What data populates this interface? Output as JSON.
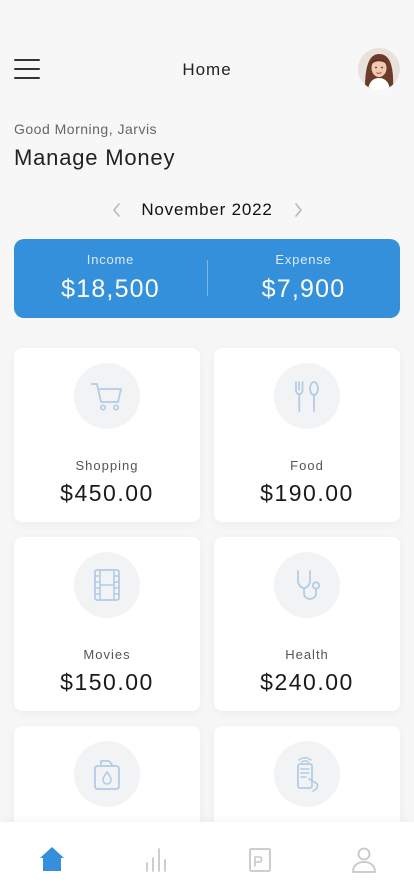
{
  "header": {
    "title": "Home"
  },
  "greeting": "Good Morning, Jarvis",
  "heading": "Manage Money",
  "month_nav": {
    "label": "November 2022"
  },
  "summary": {
    "income_label": "Income",
    "income_value": "$18,500",
    "expense_label": "Expense",
    "expense_value": "$7,900"
  },
  "categories": [
    {
      "label": "Shopping",
      "amount": "$450.00",
      "icon": "shopping-cart-icon"
    },
    {
      "label": "Food",
      "amount": "$190.00",
      "icon": "fork-spoon-icon"
    },
    {
      "label": "Movies",
      "amount": "$150.00",
      "icon": "film-icon"
    },
    {
      "label": "Health",
      "amount": "$240.00",
      "icon": "stethoscope-icon"
    },
    {
      "label": "",
      "amount": "",
      "icon": "water-bottle-icon"
    },
    {
      "label": "",
      "amount": "",
      "icon": "phone-bill-icon"
    }
  ],
  "bottom_nav": {
    "items": [
      {
        "icon": "home-icon",
        "active": true
      },
      {
        "icon": "chart-icon",
        "active": false
      },
      {
        "icon": "wallet-icon",
        "active": false
      },
      {
        "icon": "profile-icon",
        "active": false
      }
    ]
  },
  "colors": {
    "accent": "#3590dc",
    "icon_muted": "#b3cbe6",
    "nav_inactive": "#c8c8c8",
    "background": "#f7f7f7"
  }
}
